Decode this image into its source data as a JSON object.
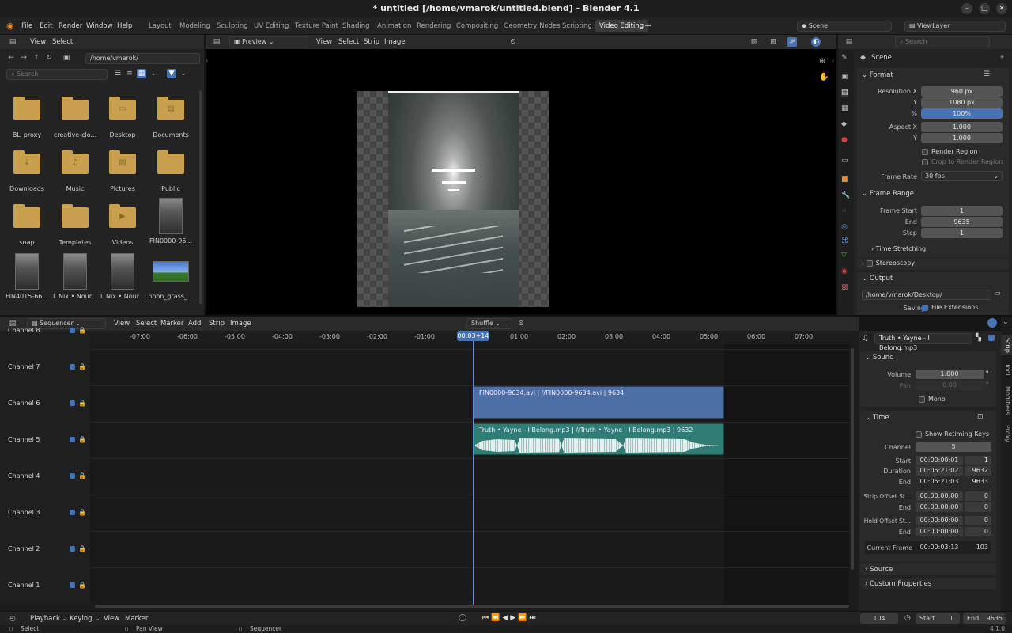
{
  "window": {
    "title": "* untitled [/home/vmarok/untitled.blend] - Blender 4.1"
  },
  "menu": [
    "File",
    "Edit",
    "Render",
    "Window",
    "Help"
  ],
  "workspaces": [
    "Layout",
    "Modeling",
    "Sculpting",
    "UV Editing",
    "Texture Paint",
    "Shading",
    "Animation",
    "Rendering",
    "Compositing",
    "Geometry Nodes",
    "Scripting",
    "Video Editing"
  ],
  "active_workspace": "Video Editing",
  "scene_field": "Scene",
  "viewlayer_field": "ViewLayer",
  "file_browser": {
    "menus": [
      "View",
      "Select"
    ],
    "path": "/home/vmarok/",
    "search_placeholder": "Search",
    "items": [
      "BL_proxy",
      "creative-clo...",
      "Desktop",
      "Documents",
      "Downloads",
      "Music",
      "Pictures",
      "Public",
      "snap",
      "Templates",
      "Videos",
      "FIN0000-96...",
      "FIN4015-66...",
      "L Nix • Nour...",
      "L Nix • Nour...",
      "noon_grass_..."
    ]
  },
  "preview": {
    "mode": "Preview",
    "menus": [
      "View",
      "Select",
      "Strip",
      "Image"
    ]
  },
  "properties": {
    "search_placeholder": "Search",
    "scene_label": "Scene",
    "format": {
      "title": "Format",
      "res_x_label": "Resolution X",
      "res_x": "960 px",
      "res_y_label": "Y",
      "res_y": "1080 px",
      "pct_label": "%",
      "pct": "100%",
      "aspect_x_label": "Aspect X",
      "aspect_x": "1.000",
      "aspect_y_label": "Y",
      "aspect_y": "1.000",
      "render_region": "Render Region",
      "crop": "Crop to Render Region",
      "framerate_label": "Frame Rate",
      "framerate": "30 fps"
    },
    "frame_range": {
      "title": "Frame Range",
      "start_label": "Frame Start",
      "start": "1",
      "end_label": "End",
      "end": "9635",
      "step_label": "Step",
      "step": "1",
      "time_stretching": "Time Stretching"
    },
    "stereoscopy": "Stereoscopy",
    "output": {
      "title": "Output",
      "path": "/home/vmarok/Desktop/",
      "saving_label": "Saving",
      "file_ext": "File Extensions"
    }
  },
  "sequencer": {
    "editor": "Sequencer",
    "menus": [
      "View",
      "Select",
      "Marker",
      "Add",
      "Strip",
      "Image"
    ],
    "overlap_mode": "Shuffle",
    "ticks": [
      "-07:00",
      "-06:00",
      "-05:00",
      "-04:00",
      "-03:00",
      "-02:00",
      "-01:00",
      "01:00",
      "02:00",
      "03:00",
      "04:00",
      "05:00",
      "06:00",
      "07:00"
    ],
    "playhead": "00:03+14",
    "channels": [
      "Channel 8",
      "Channel 7",
      "Channel 6",
      "Channel 5",
      "Channel 4",
      "Channel 3",
      "Channel 2",
      "Channel 1"
    ],
    "video_strip": "FIN0000-9634.avi | //FIN0000-9634.avi | 9634",
    "audio_strip": "Truth • Yayne - I Belong.mp3 | //Truth • Yayne - I Belong.mp3 | 9632"
  },
  "strip_panel": {
    "name": "Truth • Yayne - I Belong.mp3",
    "tabs": [
      "Strip",
      "Tool",
      "Modifiers",
      "Proxy"
    ],
    "sound": {
      "title": "Sound",
      "volume_label": "Volume",
      "volume": "1.000",
      "pan_label": "Pan",
      "pan": "0.00",
      "mono": "Mono"
    },
    "time": {
      "title": "Time",
      "show_retiming": "Show Retiming Keys",
      "channel_label": "Channel",
      "channel": "5",
      "start_label": "Start",
      "start_tc": "00:00:00:01",
      "start_f": "1",
      "duration_label": "Duration",
      "duration_tc": "00:05:21:02",
      "duration_f": "9632",
      "end_label": "End",
      "end_tc": "00:05:21:03",
      "end_f": "9633",
      "offset_start_label": "Strip Offset St...",
      "offset_start_tc": "00:00:00:00",
      "offset_start_f": "0",
      "offset_end_label": "End",
      "offset_end_tc": "00:00:00:00",
      "offset_end_f": "0",
      "hold_start_label": "Hold Offset St...",
      "hold_start_tc": "00:00:00:00",
      "hold_start_f": "0",
      "hold_end_label": "End",
      "hold_end_tc": "00:00:00:00",
      "hold_end_f": "0",
      "current_label": "Current Frame",
      "current_tc": "00:00:03:13",
      "current_f": "103"
    },
    "source": "Source",
    "custom": "Custom Properties"
  },
  "timeline_bar": {
    "playback": "Playback",
    "keying": "Keying",
    "view": "View",
    "marker": "Marker",
    "current": "104",
    "start_label": "Start",
    "start": "1",
    "end_label": "End",
    "end": "9635"
  },
  "status_bar": {
    "select": "Select",
    "pan": "Pan View",
    "editor": "Sequencer",
    "version": "4.1.0"
  }
}
